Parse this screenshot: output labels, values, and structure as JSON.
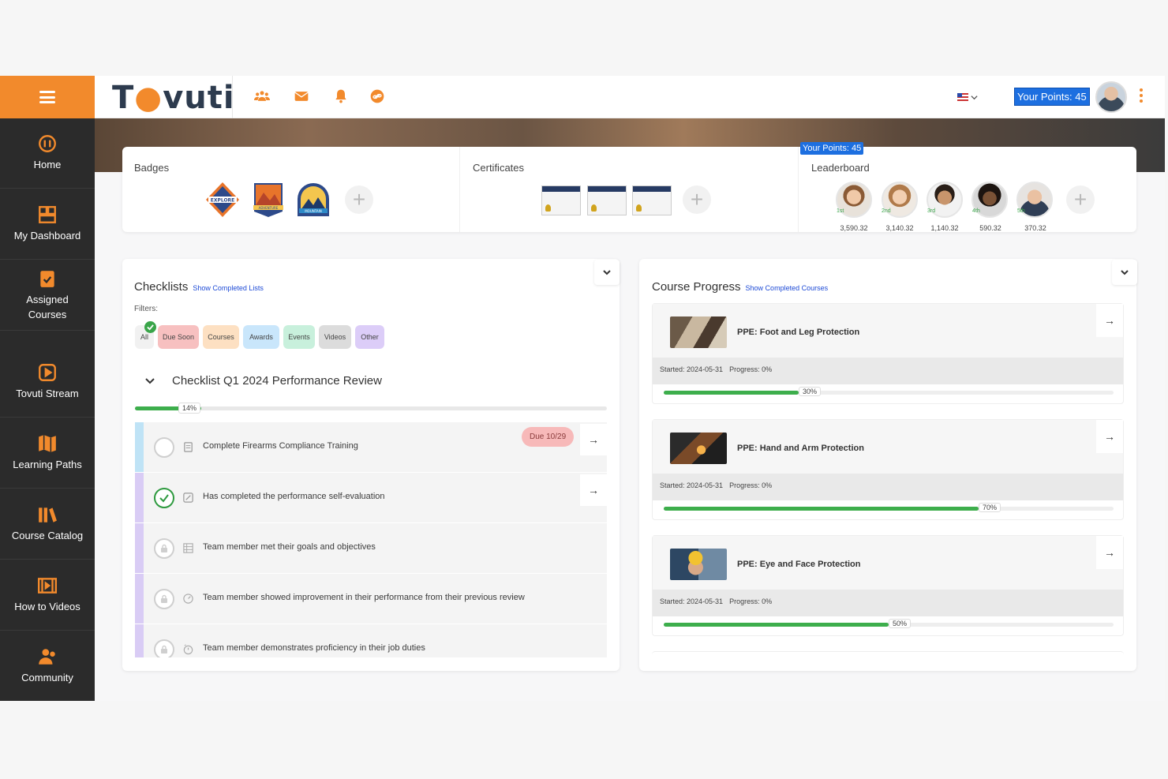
{
  "sidebar": {
    "menu_icon": "hamburger-icon",
    "items": [
      {
        "label": "Home",
        "icon": "home-info-icon"
      },
      {
        "label": "My Dashboard",
        "icon": "dashboard-icon"
      },
      {
        "label": "Assigned\nCourses",
        "icon": "clipboard-check-icon"
      },
      {
        "label": "Tovuti Stream",
        "icon": "play-icon"
      },
      {
        "label": "Learning Paths",
        "icon": "map-icon"
      },
      {
        "label": "Course Catalog",
        "icon": "books-icon"
      },
      {
        "label": "How to Videos",
        "icon": "film-icon"
      },
      {
        "label": "Community",
        "icon": "users-icon"
      }
    ]
  },
  "topbar": {
    "logo_text_a": "T",
    "logo_text_b": "vuti",
    "icons": [
      "people-icon",
      "mail-icon",
      "bell-icon",
      "link-icon"
    ],
    "language_icon": "us-flag-icon",
    "points_label": "Your Points: 45",
    "accent_color": "#f28a2c"
  },
  "badges": {
    "title": "Badges",
    "items": [
      "explore-badge",
      "adventure-badge",
      "mountain-badge"
    ],
    "badge_texts": [
      "EXPLORE",
      "ADVENTURE",
      "MOUNTAIN"
    ]
  },
  "certificates": {
    "title": "Certificates",
    "count": 3
  },
  "leaderboard": {
    "title": "Leaderboard",
    "points_tip": "Your Points: 45",
    "entries": [
      {
        "rank": "1st",
        "score": "3,590.32"
      },
      {
        "rank": "2nd",
        "score": "3,140.32"
      },
      {
        "rank": "3rd",
        "score": "1,140.32"
      },
      {
        "rank": "4th",
        "score": "590.32"
      },
      {
        "rank": "5th",
        "score": "370.32"
      }
    ]
  },
  "checklists": {
    "title": "Checklists",
    "show_completed": "Show Completed Lists",
    "filters_label": "Filters:",
    "filters": [
      {
        "label": "All",
        "color": "#f1f1f1"
      },
      {
        "label": "Due Soon",
        "color": "#f7c0c0"
      },
      {
        "label": "Courses",
        "color": "#fde0c2"
      },
      {
        "label": "Awards",
        "color": "#c9e6fb"
      },
      {
        "label": "Events",
        "color": "#c8f0dc"
      },
      {
        "label": "Videos",
        "color": "#dcdcdc"
      },
      {
        "label": "Other",
        "color": "#dccdf8"
      }
    ],
    "checklist_title": "Checklist Q1 2024 Performance Review",
    "progress": 14,
    "progress_label": "14%",
    "tasks": [
      {
        "text": "Complete Firearms Compliance Training",
        "status": "open",
        "due": "Due 10/29",
        "icon": "document-icon"
      },
      {
        "text": "Has completed the performance self-evaluation",
        "status": "done",
        "icon": "edit-icon"
      },
      {
        "text": "Team member met their goals and objectives",
        "status": "locked",
        "icon": "list-icon"
      },
      {
        "text": "Team member showed improvement in their performance from their previous review",
        "status": "locked",
        "icon": "gauge-icon"
      },
      {
        "text": "Team member demonstrates proficiency in their job duties",
        "status": "locked",
        "icon": "clock-icon"
      }
    ]
  },
  "course_progress": {
    "title": "Course Progress",
    "show_completed": "Show Completed Courses",
    "courses": [
      {
        "name": "PPE: Foot and Leg Protection",
        "started": "Started: 2024-05-31",
        "progress_text": "Progress: 0%",
        "pct": 30,
        "pct_label": "30%"
      },
      {
        "name": "PPE: Hand and Arm Protection",
        "started": "Started: 2024-05-31",
        "progress_text": "Progress: 0%",
        "pct": 70,
        "pct_label": "70%"
      },
      {
        "name": "PPE: Eye and Face Protection",
        "started": "Started: 2024-05-31",
        "progress_text": "Progress: 0%",
        "pct": 50,
        "pct_label": "50%"
      }
    ]
  }
}
